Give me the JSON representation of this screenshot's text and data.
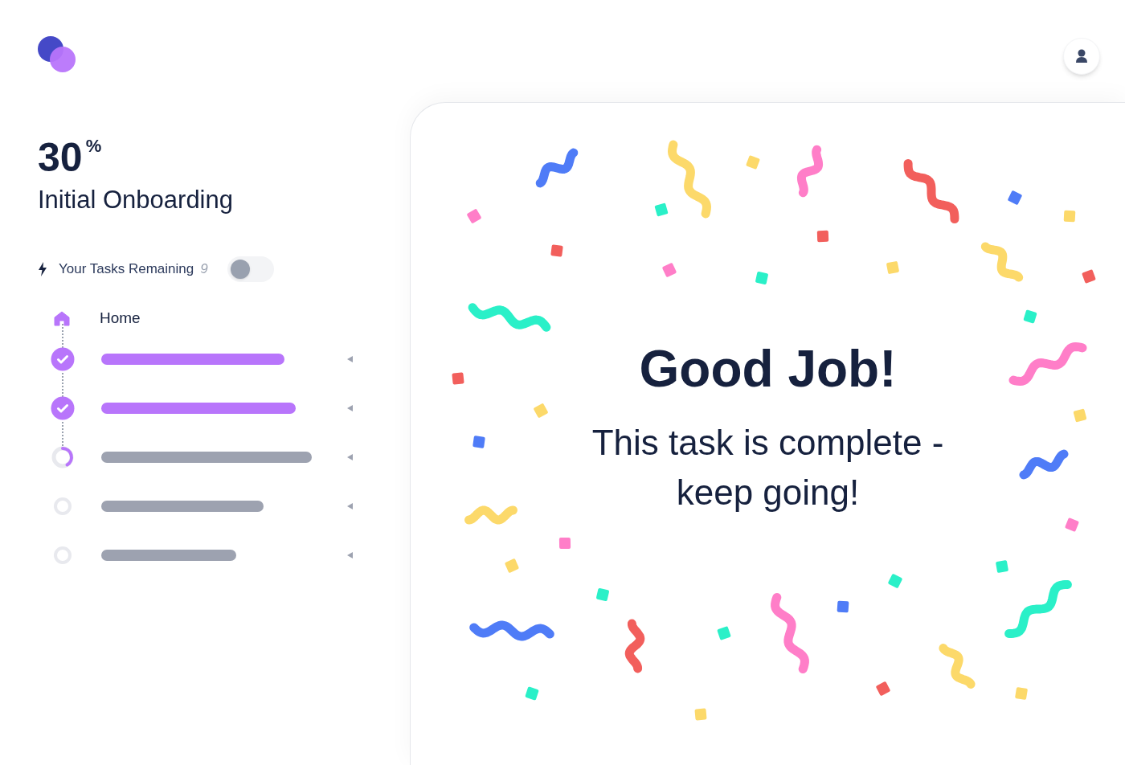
{
  "progress": {
    "percent": "30",
    "unit": "%",
    "title": "Initial Onboarding"
  },
  "tasks_remaining": {
    "label": "Your Tasks Remaining",
    "count": "9",
    "toggle_on": false
  },
  "home": {
    "label": "Home"
  },
  "tasks": [
    {
      "kind": "done"
    },
    {
      "kind": "done"
    },
    {
      "kind": "current"
    },
    {
      "kind": "todo"
    },
    {
      "kind": "todo"
    }
  ],
  "message": {
    "title": "Good Job!",
    "body": "This task is complete - keep going!"
  }
}
